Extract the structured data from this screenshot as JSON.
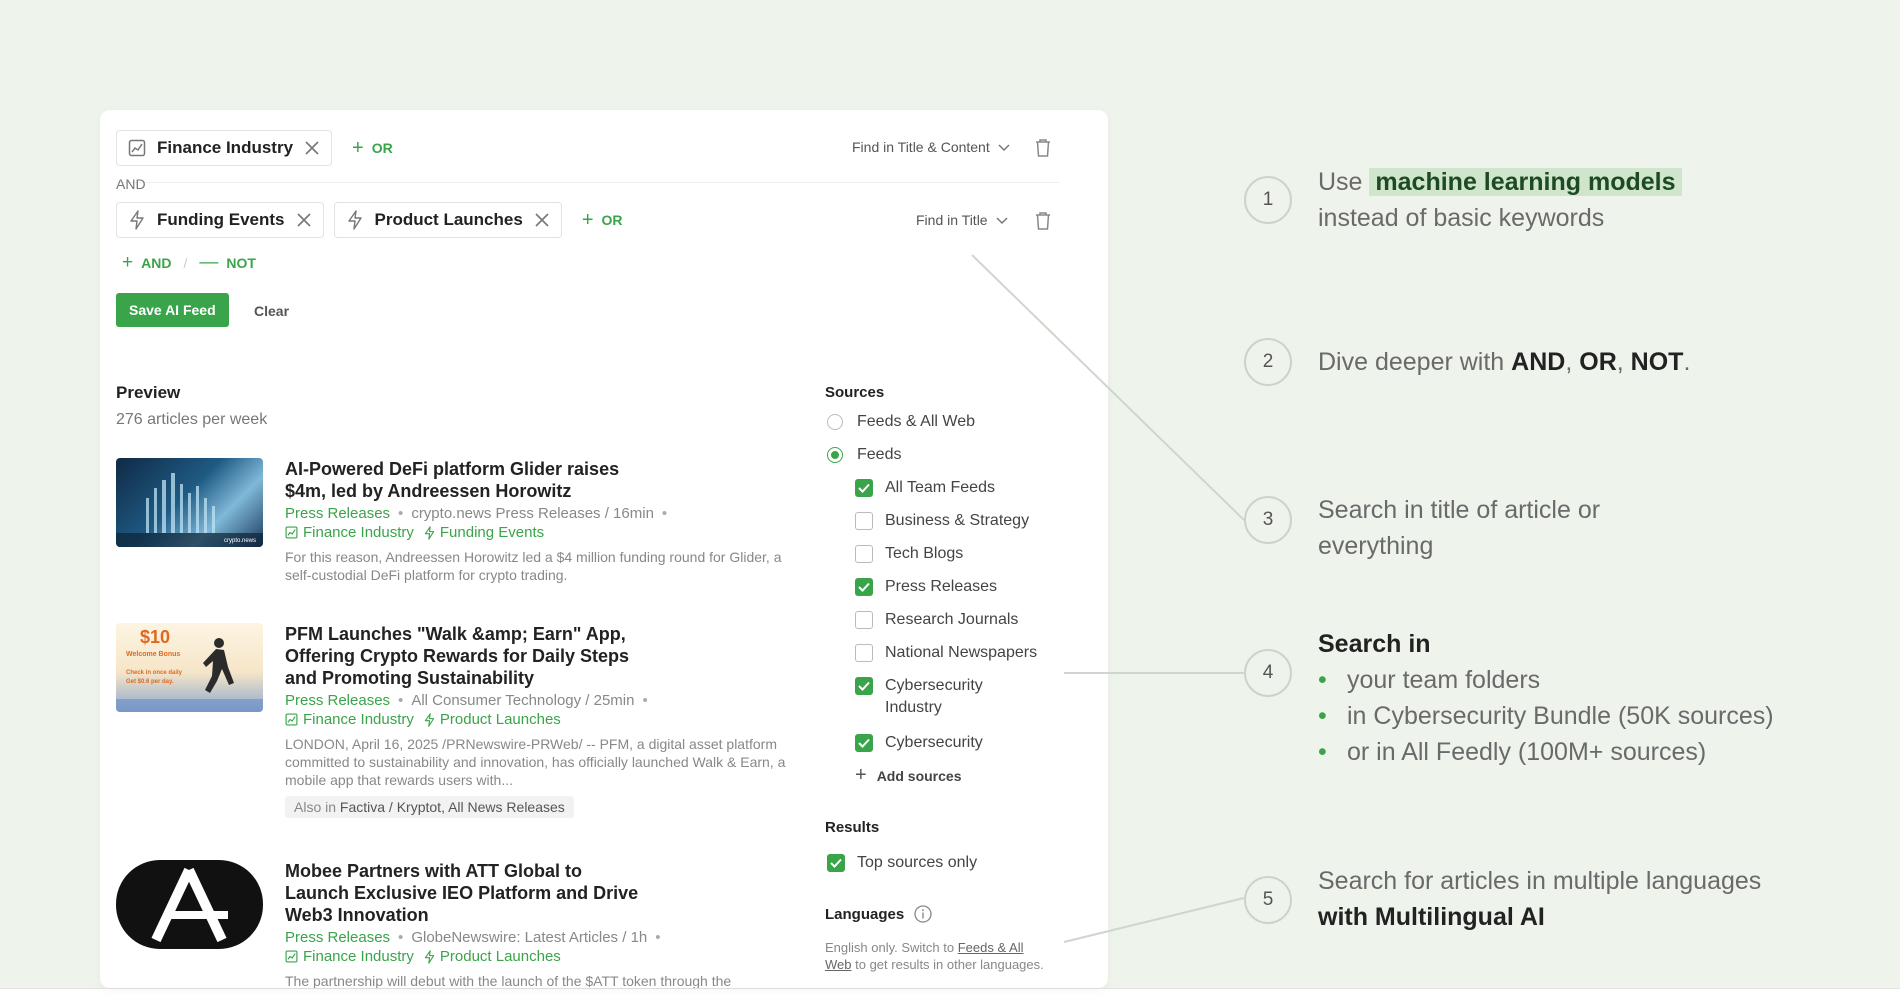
{
  "query": {
    "row1": {
      "chips": [
        {
          "label": "Finance Industry",
          "icon": "industry-icon"
        }
      ],
      "or_label": "OR",
      "find_label": "Find in Title & Content"
    },
    "and_label": "AND",
    "row2": {
      "chips": [
        {
          "label": "Funding Events",
          "icon": "bolt-icon"
        },
        {
          "label": "Product Launches",
          "icon": "bolt-icon"
        }
      ],
      "or_label": "OR",
      "find_label": "Find in Title"
    },
    "add_and_label": "AND",
    "add_not_label": "NOT",
    "save_label": "Save AI Feed",
    "clear_label": "Clear"
  },
  "preview": {
    "title": "Preview",
    "subtitle": "276 articles per week",
    "articles": [
      {
        "title": "AI-Powered DeFi platform Glider raises $4m, led by Andreessen Horowitz",
        "source": "Press Releases",
        "meta": "crypto.news Press Releases / 16min",
        "tags": [
          "Finance Industry",
          "Funding Events"
        ],
        "snippet": "For this reason, Andreessen Horowitz led a $4 million funding round for Glider, a self-custodial DeFi platform for crypto trading.",
        "thumb_watermark": "crypto.news"
      },
      {
        "title": "PFM Launches \"Walk &amp; Earn\" App, Offering Crypto Rewards for Daily Steps and Promoting Sustainability",
        "source": "Press Releases",
        "meta": "All Consumer Technology / 25min",
        "tags": [
          "Finance Industry",
          "Product Launches"
        ],
        "snippet": "LONDON, April 16, 2025 /PRNewswire-PRWeb/ -- PFM, a digital asset platform committed to sustainability and innovation, has officially launched Walk & Earn, a mobile app that rewards users with...",
        "also_prefix": "Also in",
        "also_in": "Factiva / Kryptot, All News Releases",
        "thumb_price": "$10",
        "thumb_bonus": "Welcome Bonus",
        "thumb_line1": "Check in once daily",
        "thumb_line2": "Get $0.6 per day."
      },
      {
        "title": "Mobee Partners with ATT Global to Launch Exclusive IEO Platform and Drive Web3 Innovation",
        "source": "Press Releases",
        "meta": "GlobeNewswire: Latest Articles / 1h",
        "tags": [
          "Finance Industry",
          "Product Launches"
        ],
        "snippet": "The partnership will debut with the launch of the $ATT token through the"
      }
    ]
  },
  "sources": {
    "heading": "Sources",
    "radios": [
      {
        "label": "Feeds & All Web",
        "selected": false
      },
      {
        "label": "Feeds",
        "selected": true
      }
    ],
    "checkboxes": [
      {
        "label": "All Team Feeds",
        "checked": true
      },
      {
        "label": "Business & Strategy",
        "checked": false
      },
      {
        "label": "Tech Blogs",
        "checked": false
      },
      {
        "label": "Press Releases",
        "checked": true
      },
      {
        "label": "Research Journals",
        "checked": false
      },
      {
        "label": "National Newspapers",
        "checked": false
      },
      {
        "label": "Cybersecurity Industry",
        "checked": true
      },
      {
        "label": "Cybersecurity",
        "checked": true
      }
    ],
    "add_label": "Add sources",
    "results_heading": "Results",
    "top_sources_label": "Top sources only",
    "top_sources_checked": true,
    "languages_heading": "Languages",
    "lang_note_pre": "English only. Switch to",
    "lang_note_link": "Feeds & All Web",
    "lang_note_post": "to get results in other languages."
  },
  "annotations": [
    {
      "num": "1",
      "pre": "Use",
      "highlight": "machine learning models",
      "line2": "instead of basic keywords"
    },
    {
      "num": "2",
      "pre": "Dive deeper with",
      "b1": "AND",
      "c1": ",",
      "b2": "OR",
      "c2": ",",
      "b3": "NOT",
      "end": "."
    },
    {
      "num": "3",
      "line1": "Search in title of article or",
      "line2": "everything"
    },
    {
      "num": "4",
      "heading": "Search in",
      "bullets": [
        "your team folders",
        "in Cybersecurity Bundle (50K sources)",
        "or in All Feedly (100M+ sources)"
      ]
    },
    {
      "num": "5",
      "line1": "Search for articles in multiple languages",
      "bold": "with Multilingual AI"
    }
  ],
  "colors": {
    "accent": "#3aa44a",
    "background": "#eef4ec",
    "highlight": "#cfe6cd"
  }
}
